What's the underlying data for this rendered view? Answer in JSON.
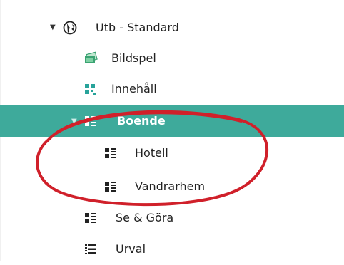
{
  "tree": {
    "items": [
      {
        "label": "Utb - Standard",
        "icon": "globe-icon",
        "expanded": true
      },
      {
        "label": "Bildspel",
        "icon": "slideshow-icon"
      },
      {
        "label": "Innehåll",
        "icon": "content-grid-icon"
      },
      {
        "label": "Boende",
        "icon": "list-icon",
        "expanded": true,
        "selected": true
      },
      {
        "label": "Hotell",
        "icon": "list-icon"
      },
      {
        "label": "Vandrarhem",
        "icon": "list-icon"
      },
      {
        "label": "Se & Göra",
        "icon": "list-icon"
      },
      {
        "label": "Urval",
        "icon": "filter-list-icon"
      }
    ]
  },
  "colors": {
    "selected_bg": "#3eaa9b",
    "annotation": "#d0202a",
    "slideshow_icon": "#3aa372",
    "content_icon": "#27a39a"
  }
}
